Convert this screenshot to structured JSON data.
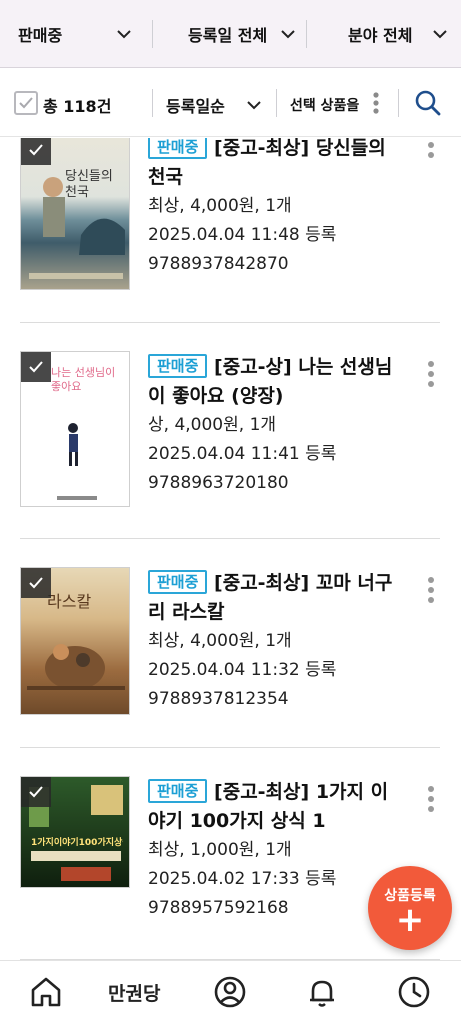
{
  "filters": {
    "status": "판매중",
    "date": "등록일 전체",
    "category": "분야 전체"
  },
  "toolbar": {
    "total": "총 118건",
    "sort": "등록일순",
    "select_action": "선택 상품을"
  },
  "items": [
    {
      "badge": "판매중",
      "title": "[중고-최상] 당신들의 천국",
      "price_line": "최상, 4,000원, 1개",
      "date_line": "2025.04.04 11:48 등록",
      "isbn": "9788937842870",
      "cover_text": "당신들의 천국"
    },
    {
      "badge": "판매중",
      "title": "[중고-상] 나는 선생님이 좋아요 (양장)",
      "price_line": "상, 4,000원, 1개",
      "date_line": "2025.04.04 11:41 등록",
      "isbn": "9788963720180",
      "cover_text": "나는 선생님이 좋아요"
    },
    {
      "badge": "판매중",
      "title": "[중고-최상] 꼬마 너구리 라스칼",
      "price_line": "최상, 4,000원, 1개",
      "date_line": "2025.04.04 11:32 등록",
      "isbn": "9788937812354",
      "cover_text": "라스칼"
    },
    {
      "badge": "판매중",
      "title": "[중고-최상] 1가지 이야기 100가지 상식 1",
      "price_line": "최상, 1,000원, 1개",
      "date_line": "2025.04.02 17:33 등록",
      "isbn": "9788957592168",
      "cover_text": "1가지이야기100가지상식"
    }
  ],
  "fab": {
    "label": "상품등록",
    "icon": "plus-icon"
  },
  "bottom_nav": {
    "shop_label": "만권당"
  },
  "colors": {
    "badge": "#2aa6d8",
    "fab": "#f25a3a",
    "header_bg": "#f6f2f7"
  }
}
